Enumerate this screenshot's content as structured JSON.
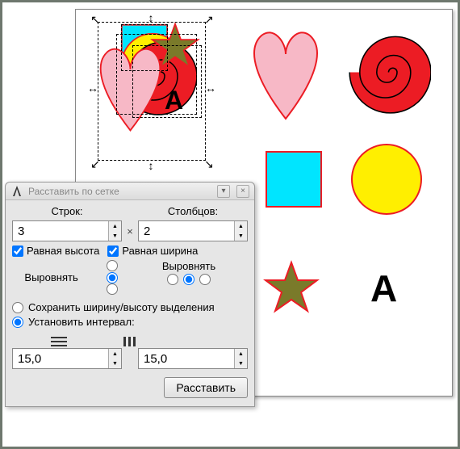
{
  "dialog": {
    "title": "Расставить по сетке",
    "rows_label": "Строк:",
    "cols_label": "Столбцов:",
    "rows_value": "3",
    "cols_value": "2",
    "equal_height": "Равная высота",
    "equal_width": "Равная ширина",
    "align_label": "Выровнять",
    "keep_extent": "Сохранить ширину/высоту выделения",
    "set_interval": "Установить интервал:",
    "hspacing": "15,0",
    "vspacing": "15,0",
    "arrange_btn": "Расставить"
  },
  "canvas": {
    "letter": "A",
    "letter_right": "A",
    "shapes": [
      "heart-pink",
      "spiral-red",
      "square-cyan",
      "circle-yellow",
      "star-olive",
      "text-A"
    ],
    "colors": {
      "pink": "#f7b8c6",
      "red": "#ec1c24",
      "cyan": "#00e5ff",
      "yellow": "#ffef00",
      "olive": "#7a7a2a"
    }
  }
}
